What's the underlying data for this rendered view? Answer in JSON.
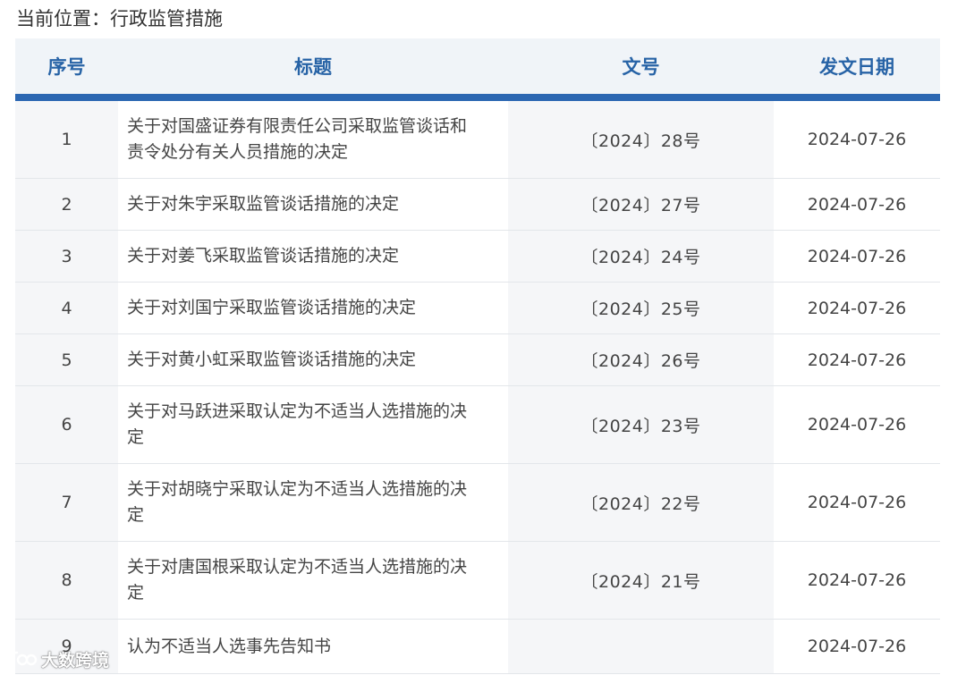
{
  "breadcrumb": {
    "text": "当前位置：行政监管措施"
  },
  "table": {
    "headers": [
      "序号",
      "标题",
      "文号",
      "发文日期"
    ],
    "rows": [
      {
        "index": "1",
        "title_lines": [
          "关于对国盛证券有限责任公司采取监管谈话和",
          "责令处分有关人员措施的决定"
        ],
        "doc_no": "〔2024〕28号",
        "date": "2024-07-26"
      },
      {
        "index": "2",
        "title_lines": [
          "关于对朱宇采取监管谈话措施的决定"
        ],
        "doc_no": "〔2024〕27号",
        "date": "2024-07-26"
      },
      {
        "index": "3",
        "title_lines": [
          "关于对姜飞采取监管谈话措施的决定"
        ],
        "doc_no": "〔2024〕24号",
        "date": "2024-07-26"
      },
      {
        "index": "4",
        "title_lines": [
          "关于对刘国宁采取监管谈话措施的决定"
        ],
        "doc_no": "〔2024〕25号",
        "date": "2024-07-26"
      },
      {
        "index": "5",
        "title_lines": [
          "关于对黄小虹采取监管谈话措施的决定"
        ],
        "doc_no": "〔2024〕26号",
        "date": "2024-07-26"
      },
      {
        "index": "6",
        "title_lines": [
          "关于对马跃进采取认定为不适当人选措施的决",
          "定"
        ],
        "doc_no": "〔2024〕23号",
        "date": "2024-07-26"
      },
      {
        "index": "7",
        "title_lines": [
          "关于对胡晓宁采取认定为不适当人选措施的决",
          "定"
        ],
        "doc_no": "〔2024〕22号",
        "date": "2024-07-26"
      },
      {
        "index": "8",
        "title_lines": [
          "关于对唐国根采取认定为不适当人选措施的决",
          "定"
        ],
        "doc_no": "〔2024〕21号",
        "date": "2024-07-26"
      },
      {
        "index": "9",
        "title_lines": [
          "认为不适当人选事先告知书"
        ],
        "doc_no": "",
        "date": "2024-07-26"
      }
    ]
  },
  "watermark": {
    "text": "大数跨境",
    "icon": "brand-logo-icon"
  }
}
